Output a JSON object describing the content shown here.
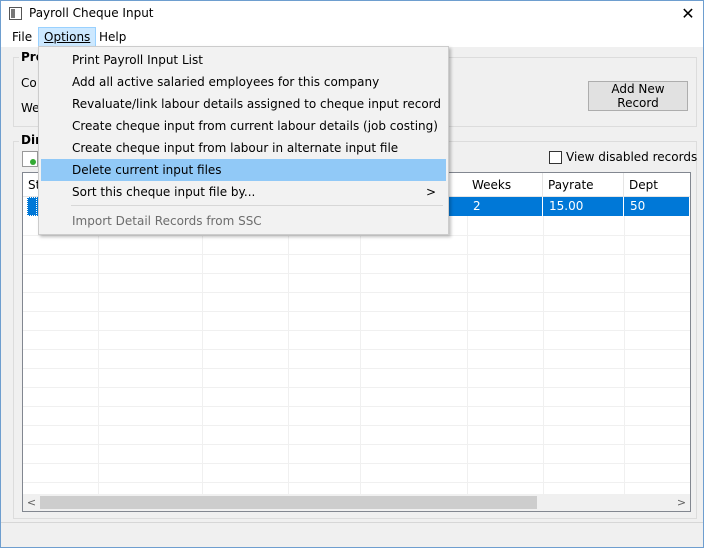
{
  "window": {
    "title": "Payroll Cheque Input",
    "close_glyph": "✕"
  },
  "menubar": {
    "items": [
      "File",
      "Options",
      "Help"
    ]
  },
  "background": {
    "group1_title": "Pro",
    "label_co": "Co",
    "label_we": "We",
    "add_new_record": "Add New Record",
    "group2_title": "Dir",
    "view_disabled": "View disabled records"
  },
  "grid": {
    "columns": [
      "St",
      "Weeks",
      "Payrate",
      "Dept"
    ],
    "row": {
      "weeks": "2",
      "payrate": "15.00",
      "dept": "50"
    },
    "scroll_left": "<",
    "scroll_right": ">"
  },
  "dropdown": {
    "items": [
      "Print Payroll Input List",
      "Add all active salaried employees for this company",
      "Revaluate/link labour details assigned to cheque input record",
      "Create cheque input from current labour details (job costing)",
      "Create cheque input from labour in alternate input file",
      "Delete current input files",
      "Sort this cheque input file by...",
      "Import Detail Records from SSC"
    ],
    "submenu_arrow": ">"
  },
  "colors": {
    "selection": "#0078d7",
    "menu_hover": "#91c9f7",
    "menu_active": "#cce8ff"
  },
  "icons": {
    "app": "window-icon",
    "close": "close-icon",
    "add": "add-record-icon"
  }
}
